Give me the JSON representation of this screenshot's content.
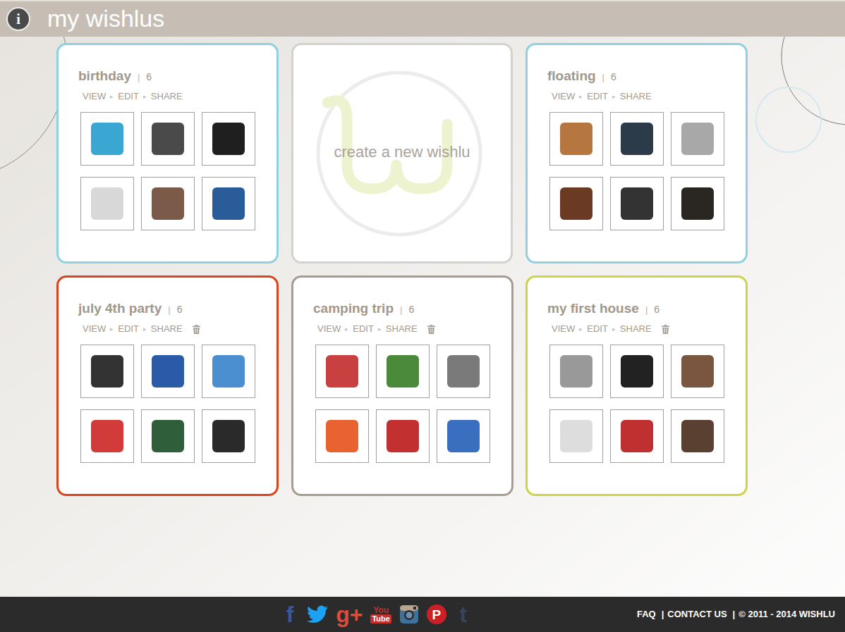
{
  "header": {
    "info_icon": "i",
    "title": "my wishlus"
  },
  "wishlist_actions": {
    "items": [
      "VIEW",
      "EDIT",
      "SHARE"
    ],
    "separator": "▸"
  },
  "count_separator": "|",
  "create_card": {
    "label": "create a new wishlu"
  },
  "wishlists": [
    {
      "title": "birthday",
      "count": "6",
      "color": "#8fd0e1",
      "deletable": false,
      "thumbnails": [
        {
          "color": "#3aa6d2"
        },
        {
          "color": "#4a4a4a"
        },
        {
          "color": "#1f1f1f"
        },
        {
          "color": "#d8d8d8"
        },
        {
          "color": "#7b5a4a"
        },
        {
          "color": "#2b5c9a"
        }
      ]
    },
    {
      "title": "floating",
      "count": "6",
      "color": "#8fd0e1",
      "deletable": false,
      "thumbnails": [
        {
          "color": "#b5773f"
        },
        {
          "color": "#2b3b4a"
        },
        {
          "color": "#a8a8a8"
        },
        {
          "color": "#6b3a22"
        },
        {
          "color": "#333333"
        },
        {
          "color": "#2a2622"
        }
      ]
    },
    {
      "title": "july 4th party",
      "count": "6",
      "color": "#d9441e",
      "deletable": true,
      "thumbnails": [
        {
          "color": "#333333"
        },
        {
          "color": "#2a5aa8"
        },
        {
          "color": "#4b8fd0"
        },
        {
          "color": "#d33a3a"
        },
        {
          "color": "#2f5e3b"
        },
        {
          "color": "#2a2a2a"
        }
      ]
    },
    {
      "title": "camping trip",
      "count": "6",
      "color": "#a89c8f",
      "deletable": true,
      "thumbnails": [
        {
          "color": "#c84040"
        },
        {
          "color": "#4a8a3a"
        },
        {
          "color": "#7a7a7a"
        },
        {
          "color": "#e8632f"
        },
        {
          "color": "#c23030"
        },
        {
          "color": "#3a6fc0"
        }
      ]
    },
    {
      "title": "my first house",
      "count": "6",
      "color": "#cfd34a",
      "deletable": true,
      "thumbnails": [
        {
          "color": "#999999"
        },
        {
          "color": "#222222"
        },
        {
          "color": "#7a5540"
        },
        {
          "color": "#dddddd"
        },
        {
          "color": "#c03030"
        },
        {
          "color": "#5a4030"
        }
      ]
    }
  ],
  "footer": {
    "social": [
      {
        "kind": "text",
        "glyph": "f",
        "color": "#3b5998"
      },
      {
        "kind": "twitter",
        "color": "#1da1f2"
      },
      {
        "kind": "text",
        "glyph": "g+",
        "color": "#dd4b39"
      },
      {
        "kind": "youtube",
        "glyph": "You",
        "glyph2": "Tube",
        "color": "#c4302b"
      },
      {
        "kind": "instagram",
        "color": "#3f729b"
      },
      {
        "kind": "badge",
        "glyph": "P",
        "color": "#cb2027"
      },
      {
        "kind": "text",
        "glyph": "t",
        "color": "#35465c"
      }
    ],
    "links": [
      "FAQ",
      "CONTACT US"
    ],
    "separator": "|",
    "copyright": "© 2011 - 2014 WISHLU"
  }
}
